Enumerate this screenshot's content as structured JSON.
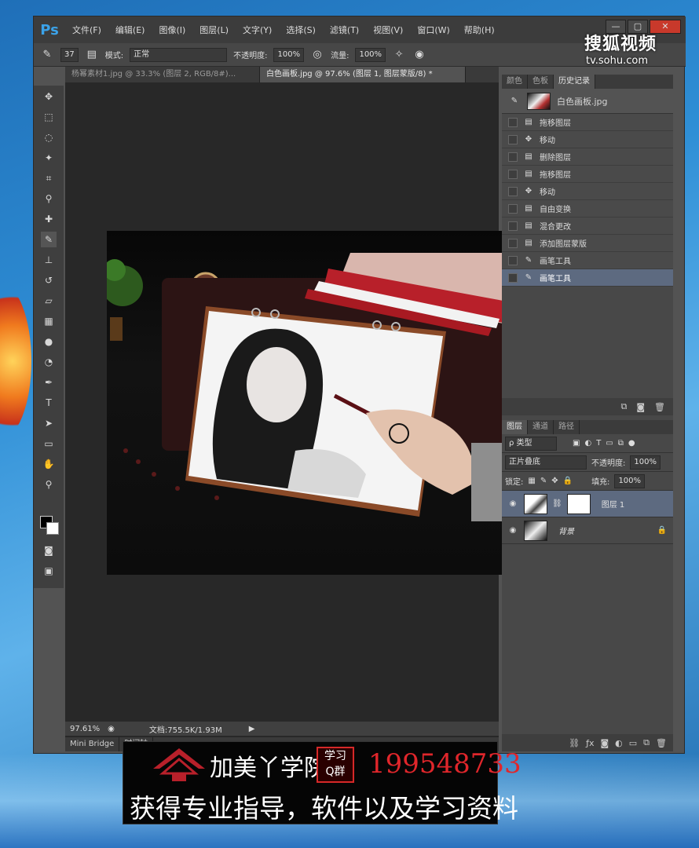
{
  "app": {
    "logo": "Ps",
    "menu": [
      "文件(F)",
      "编辑(E)",
      "图像(I)",
      "图层(L)",
      "文字(Y)",
      "选择(S)",
      "滤镜(T)",
      "视图(V)",
      "窗口(W)",
      "帮助(H)"
    ],
    "window_buttons": [
      "—",
      "▢",
      "✕"
    ]
  },
  "options": {
    "brush_size": "37",
    "mode_label": "模式:",
    "mode_value": "正常",
    "opacity_label": "不透明度:",
    "opacity_value": "100%",
    "flow_label": "流量:",
    "flow_value": "100%"
  },
  "doc_tabs": [
    {
      "label": "杨幂素材1.jpg @ 33.3% (图层 2, RGB/8#)...",
      "active": false
    },
    {
      "label": "白色画板.jpg @ 97.6% (图层 1, 图层蒙版/8) *",
      "active": true
    }
  ],
  "status": {
    "zoom": "97.61%",
    "doc_info": "文档:755.5K/1.93M"
  },
  "bottom_tabs": [
    "Mini Bridge",
    "时间轴"
  ],
  "panels": {
    "top_tabs": [
      "颜色",
      "色板",
      "历史记录"
    ],
    "history": {
      "snapshot": "白色画板.jpg",
      "items": [
        {
          "label": "拖移图层",
          "icon": "layer-icon"
        },
        {
          "label": "移动",
          "icon": "move-icon"
        },
        {
          "label": "删除图层",
          "icon": "layer-icon"
        },
        {
          "label": "拖移图层",
          "icon": "layer-icon"
        },
        {
          "label": "移动",
          "icon": "move-icon"
        },
        {
          "label": "自由变换",
          "icon": "layer-icon"
        },
        {
          "label": "混合更改",
          "icon": "layer-icon"
        },
        {
          "label": "添加图层蒙版",
          "icon": "layer-icon"
        },
        {
          "label": "画笔工具",
          "icon": "brush-icon"
        },
        {
          "label": "画笔工具",
          "icon": "brush-icon",
          "selected": true
        }
      ]
    },
    "layers": {
      "tabs": [
        "图层",
        "通道",
        "路径"
      ],
      "filter_label": "ρ 类型",
      "blend_mode": "正片叠底",
      "opacity_label": "不透明度:",
      "opacity_value": "100%",
      "lock_label": "锁定:",
      "fill_label": "填充:",
      "fill_value": "100%",
      "items": [
        {
          "name": "图层 1",
          "selected": true
        },
        {
          "name": "背景",
          "locked": true
        }
      ]
    }
  },
  "watermark": {
    "main": "搜狐视频",
    "sub": "tv.sohu.com"
  },
  "banner": {
    "brand": "加美丫学院",
    "badge": "学习\nQ群",
    "qq": "199548733",
    "tagline": "获得专业指导，软件以及学习资料"
  },
  "colors": {
    "chrome_dark": "#3c3c3c",
    "chrome": "#535353",
    "selected": "#5d6a80",
    "ps_blue": "#3ba2e8",
    "banner_red": "#e0262b"
  }
}
